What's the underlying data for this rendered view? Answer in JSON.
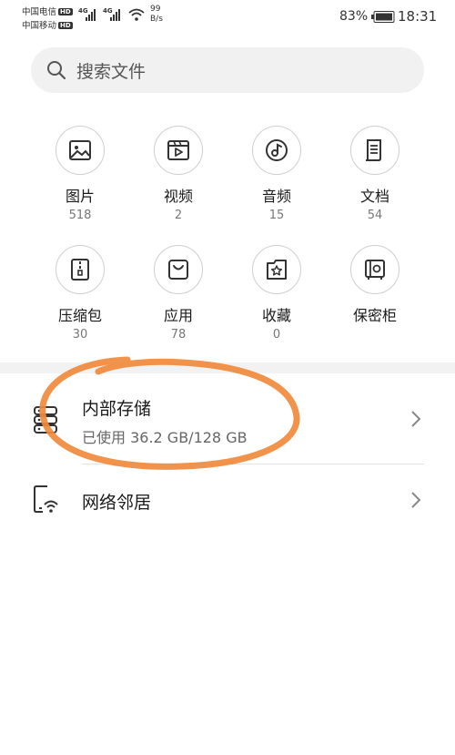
{
  "status_bar": {
    "carrier1": "中国电信",
    "carrier2": "中国移动",
    "hd": "HD",
    "net1": "4G",
    "net2": "4G",
    "speed_value": "99",
    "speed_unit": "B/s",
    "battery": "83%",
    "time": "18:31"
  },
  "search": {
    "placeholder": "搜索文件"
  },
  "categories": [
    {
      "label": "图片",
      "count": "518",
      "icon": "image-icon"
    },
    {
      "label": "视频",
      "count": "2",
      "icon": "video-icon"
    },
    {
      "label": "音频",
      "count": "15",
      "icon": "music-icon"
    },
    {
      "label": "文档",
      "count": "54",
      "icon": "document-icon"
    },
    {
      "label": "压缩包",
      "count": "30",
      "icon": "archive-icon"
    },
    {
      "label": "应用",
      "count": "78",
      "icon": "app-bag-icon"
    },
    {
      "label": "收藏",
      "count": "0",
      "icon": "favorite-icon"
    },
    {
      "label": "保密柜",
      "count": "",
      "icon": "safe-icon"
    }
  ],
  "storage": {
    "title": "内部存储",
    "subtitle": "已使用 36.2 GB/128 GB"
  },
  "network": {
    "title": "网络邻居"
  },
  "colors": {
    "annotation": "#f08a3c",
    "icon_stroke": "#333333"
  }
}
